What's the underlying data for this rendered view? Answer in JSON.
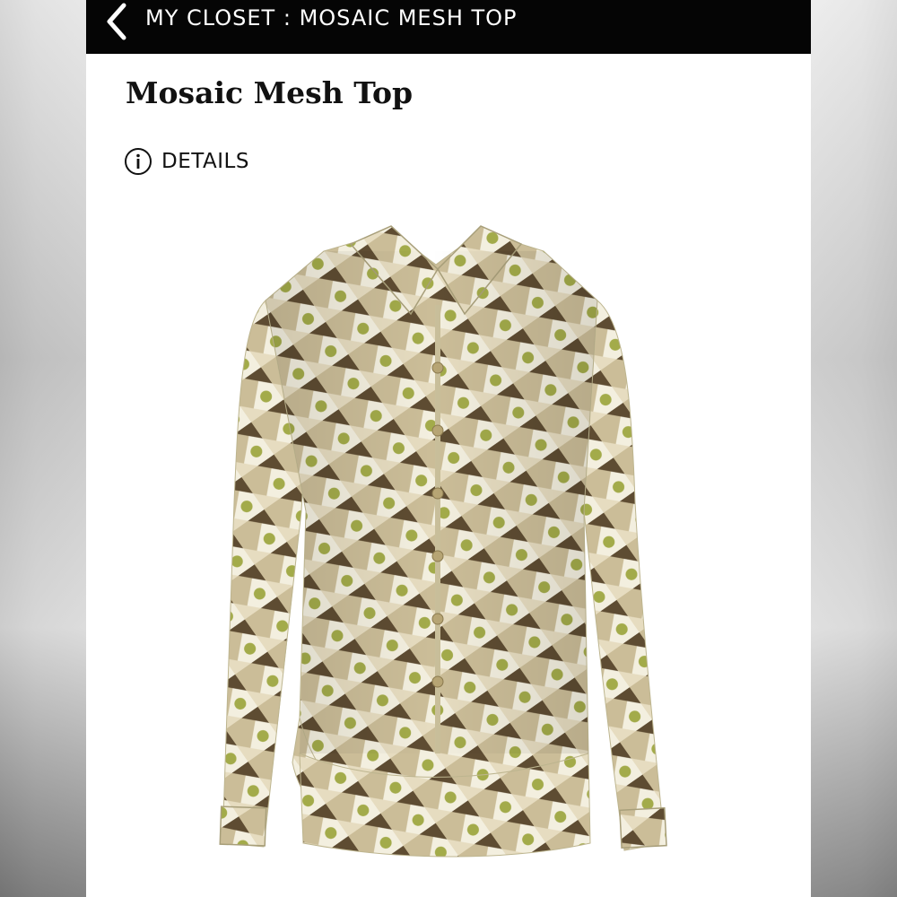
{
  "header": {
    "back_icon": "chevron-left-icon",
    "breadcrumb": "MY CLOSET : MOSAIC MESH TOP"
  },
  "item": {
    "title": "Mosaic Mesh Top",
    "details_icon": "info-circle-icon",
    "details_label": "DETAILS"
  },
  "colors": {
    "topbar": "#050505",
    "pattern_cream": "#f3efdf",
    "pattern_tan": "#cbbd98",
    "pattern_brown": "#5e4c32",
    "pattern_olive": "#a3ab4a"
  }
}
